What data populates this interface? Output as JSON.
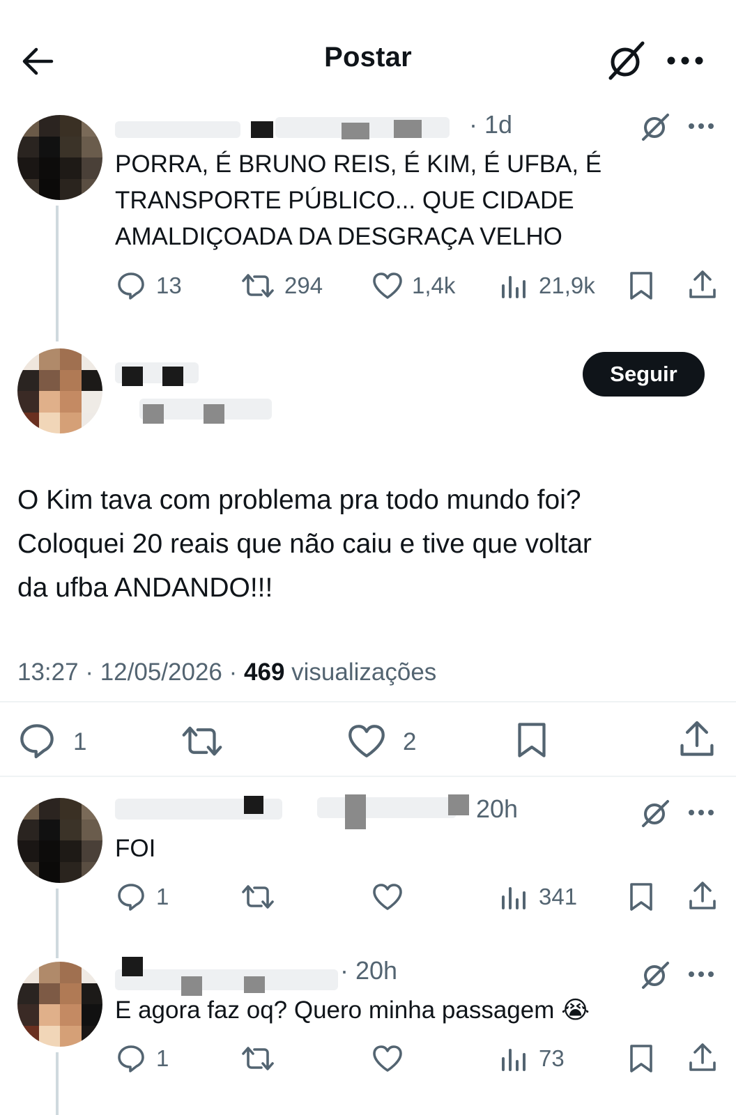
{
  "header": {
    "title": "Postar",
    "back_icon": "arrow-left-icon",
    "grok_icon": "grok-icon",
    "more_icon": "more-icon"
  },
  "quoted_post": {
    "time": "· 1d",
    "text_lines": [
      "PORRA, É BRUNO REIS, É KIM, É UFBA, É",
      "TRANSPORTE PÚBLICO... QUE CIDADE",
      "AMALDIÇOADA DA DESGRAÇA VELHO"
    ],
    "stats": {
      "replies": "13",
      "reposts": "294",
      "likes": "1,4k",
      "views": "21,9k"
    }
  },
  "main_post": {
    "follow_label": "Seguir",
    "text_lines": [
      "O Kim tava com problema pra todo mundo foi?",
      "Coloquei 20 reais que não caiu e tive que voltar",
      "da ufba ANDANDO!!!"
    ],
    "time": "13:27",
    "date": "12/05/2026",
    "views_count": "469",
    "views_label": "visualizações",
    "stats": {
      "replies": "1",
      "likes": "2"
    }
  },
  "replies": [
    {
      "time": "20h",
      "text": "FOI",
      "stats": {
        "replies": "1",
        "views": "341"
      }
    },
    {
      "time": "· 20h",
      "text": "E agora faz oq? Quero minha passagem 😭",
      "stats": {
        "replies": "1",
        "views": "73"
      }
    }
  ],
  "colors": {
    "text": "#0f1419",
    "secondary": "#536471",
    "button": "#0f1419",
    "divider": "#eff3f4"
  }
}
